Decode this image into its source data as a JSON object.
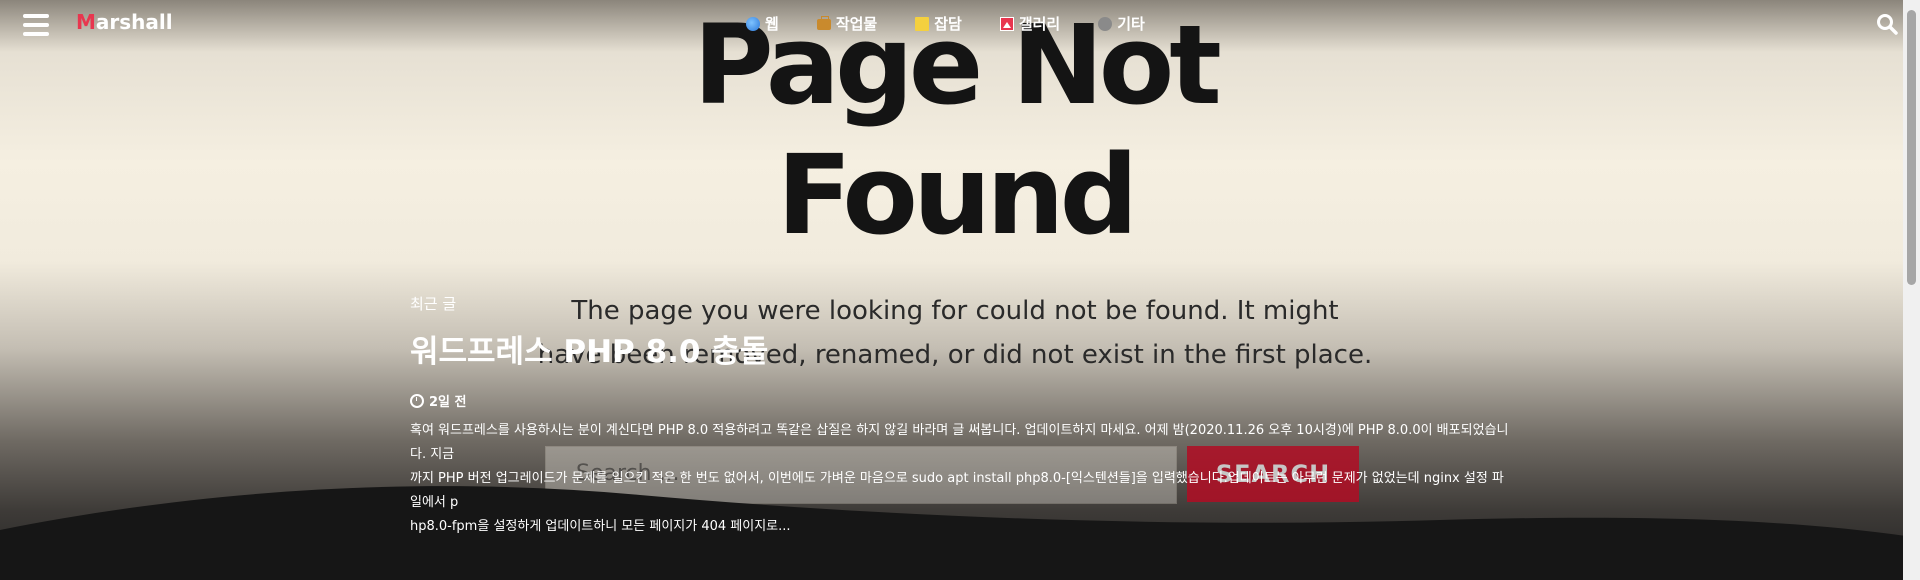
{
  "background": {
    "title_line1": "Page Not",
    "title_line2": "Found",
    "message_line1": "The page you were looking for could not be found. It might",
    "message_line2": "have been removed, renamed, or did not exist in the first place.",
    "search_placeholder": "Search ...",
    "search_button": "SEARCH"
  },
  "header": {
    "logo_m": "M",
    "logo_rest": "arshall",
    "nav": [
      {
        "label": "웹",
        "icon": "globe-icon"
      },
      {
        "label": "작업물",
        "icon": "briefcase-icon"
      },
      {
        "label": "잡담",
        "icon": "note-icon"
      },
      {
        "label": "갤러리",
        "icon": "picture-icon"
      },
      {
        "label": "기타",
        "icon": "speech-bubble-icon"
      }
    ]
  },
  "post": {
    "section_label": "최근 글",
    "title": "워드프레스 PHP 8.0 충돌",
    "time": "2일 전",
    "excerpt_line1": "혹여 워드프레스를 사용하시는 분이 계신다면 PHP 8.0 적용하려고 똑같은 삽질은 하지 않길 바라며 글 써봅니다. 업데이트하지 마세요. 어제 밤(2020.11.26 오후 10시경)에 PHP 8.0.0이 배포되었습니다. 지금",
    "excerpt_line2": "까지 PHP 버전 업그레이드가 문제를 일으킨 적은 한 번도 없어서, 이번에도 가벼운 마음으로 sudo apt install php8.0-[익스텐션들]을 입력했습니다.업데이트는 아무런 문제가 없었는데 nginx 설정 파일에서 p",
    "excerpt_line3": "hp8.0-fpm을 설정하게 업데이트하니 모든 페이지가 404 페이지로..."
  },
  "colors": {
    "accent": "#e8364f",
    "button_red": "#b10d24",
    "dark": "#161616"
  }
}
